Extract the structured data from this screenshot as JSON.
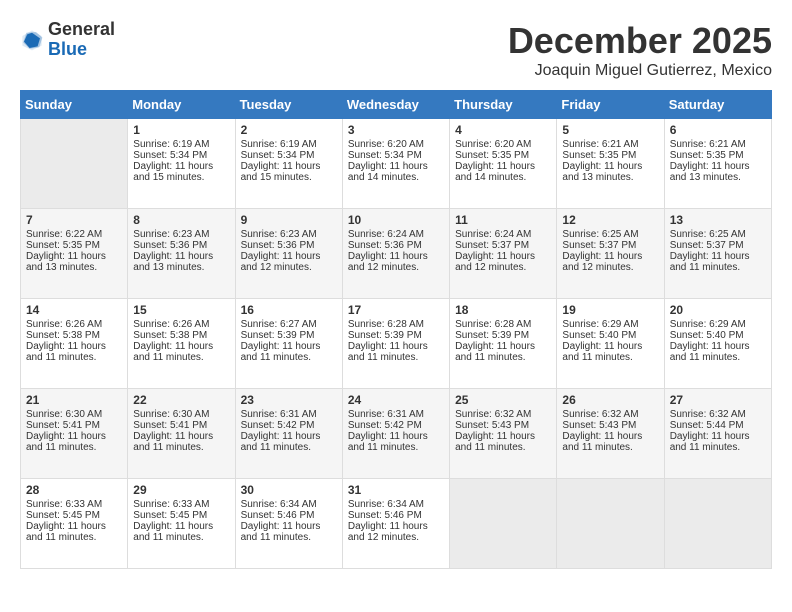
{
  "header": {
    "logo_general": "General",
    "logo_blue": "Blue",
    "month_title": "December 2025",
    "subtitle": "Joaquin Miguel Gutierrez, Mexico"
  },
  "days_of_week": [
    "Sunday",
    "Monday",
    "Tuesday",
    "Wednesday",
    "Thursday",
    "Friday",
    "Saturday"
  ],
  "weeks": [
    [
      {
        "day": "",
        "sunrise": "",
        "sunset": "",
        "daylight": ""
      },
      {
        "day": "1",
        "sunrise": "Sunrise: 6:19 AM",
        "sunset": "Sunset: 5:34 PM",
        "daylight": "Daylight: 11 hours and 15 minutes."
      },
      {
        "day": "2",
        "sunrise": "Sunrise: 6:19 AM",
        "sunset": "Sunset: 5:34 PM",
        "daylight": "Daylight: 11 hours and 15 minutes."
      },
      {
        "day": "3",
        "sunrise": "Sunrise: 6:20 AM",
        "sunset": "Sunset: 5:34 PM",
        "daylight": "Daylight: 11 hours and 14 minutes."
      },
      {
        "day": "4",
        "sunrise": "Sunrise: 6:20 AM",
        "sunset": "Sunset: 5:35 PM",
        "daylight": "Daylight: 11 hours and 14 minutes."
      },
      {
        "day": "5",
        "sunrise": "Sunrise: 6:21 AM",
        "sunset": "Sunset: 5:35 PM",
        "daylight": "Daylight: 11 hours and 13 minutes."
      },
      {
        "day": "6",
        "sunrise": "Sunrise: 6:21 AM",
        "sunset": "Sunset: 5:35 PM",
        "daylight": "Daylight: 11 hours and 13 minutes."
      }
    ],
    [
      {
        "day": "7",
        "sunrise": "Sunrise: 6:22 AM",
        "sunset": "Sunset: 5:35 PM",
        "daylight": "Daylight: 11 hours and 13 minutes."
      },
      {
        "day": "8",
        "sunrise": "Sunrise: 6:23 AM",
        "sunset": "Sunset: 5:36 PM",
        "daylight": "Daylight: 11 hours and 13 minutes."
      },
      {
        "day": "9",
        "sunrise": "Sunrise: 6:23 AM",
        "sunset": "Sunset: 5:36 PM",
        "daylight": "Daylight: 11 hours and 12 minutes."
      },
      {
        "day": "10",
        "sunrise": "Sunrise: 6:24 AM",
        "sunset": "Sunset: 5:36 PM",
        "daylight": "Daylight: 11 hours and 12 minutes."
      },
      {
        "day": "11",
        "sunrise": "Sunrise: 6:24 AM",
        "sunset": "Sunset: 5:37 PM",
        "daylight": "Daylight: 11 hours and 12 minutes."
      },
      {
        "day": "12",
        "sunrise": "Sunrise: 6:25 AM",
        "sunset": "Sunset: 5:37 PM",
        "daylight": "Daylight: 11 hours and 12 minutes."
      },
      {
        "day": "13",
        "sunrise": "Sunrise: 6:25 AM",
        "sunset": "Sunset: 5:37 PM",
        "daylight": "Daylight: 11 hours and 11 minutes."
      }
    ],
    [
      {
        "day": "14",
        "sunrise": "Sunrise: 6:26 AM",
        "sunset": "Sunset: 5:38 PM",
        "daylight": "Daylight: 11 hours and 11 minutes."
      },
      {
        "day": "15",
        "sunrise": "Sunrise: 6:26 AM",
        "sunset": "Sunset: 5:38 PM",
        "daylight": "Daylight: 11 hours and 11 minutes."
      },
      {
        "day": "16",
        "sunrise": "Sunrise: 6:27 AM",
        "sunset": "Sunset: 5:39 PM",
        "daylight": "Daylight: 11 hours and 11 minutes."
      },
      {
        "day": "17",
        "sunrise": "Sunrise: 6:28 AM",
        "sunset": "Sunset: 5:39 PM",
        "daylight": "Daylight: 11 hours and 11 minutes."
      },
      {
        "day": "18",
        "sunrise": "Sunrise: 6:28 AM",
        "sunset": "Sunset: 5:39 PM",
        "daylight": "Daylight: 11 hours and 11 minutes."
      },
      {
        "day": "19",
        "sunrise": "Sunrise: 6:29 AM",
        "sunset": "Sunset: 5:40 PM",
        "daylight": "Daylight: 11 hours and 11 minutes."
      },
      {
        "day": "20",
        "sunrise": "Sunrise: 6:29 AM",
        "sunset": "Sunset: 5:40 PM",
        "daylight": "Daylight: 11 hours and 11 minutes."
      }
    ],
    [
      {
        "day": "21",
        "sunrise": "Sunrise: 6:30 AM",
        "sunset": "Sunset: 5:41 PM",
        "daylight": "Daylight: 11 hours and 11 minutes."
      },
      {
        "day": "22",
        "sunrise": "Sunrise: 6:30 AM",
        "sunset": "Sunset: 5:41 PM",
        "daylight": "Daylight: 11 hours and 11 minutes."
      },
      {
        "day": "23",
        "sunrise": "Sunrise: 6:31 AM",
        "sunset": "Sunset: 5:42 PM",
        "daylight": "Daylight: 11 hours and 11 minutes."
      },
      {
        "day": "24",
        "sunrise": "Sunrise: 6:31 AM",
        "sunset": "Sunset: 5:42 PM",
        "daylight": "Daylight: 11 hours and 11 minutes."
      },
      {
        "day": "25",
        "sunrise": "Sunrise: 6:32 AM",
        "sunset": "Sunset: 5:43 PM",
        "daylight": "Daylight: 11 hours and 11 minutes."
      },
      {
        "day": "26",
        "sunrise": "Sunrise: 6:32 AM",
        "sunset": "Sunset: 5:43 PM",
        "daylight": "Daylight: 11 hours and 11 minutes."
      },
      {
        "day": "27",
        "sunrise": "Sunrise: 6:32 AM",
        "sunset": "Sunset: 5:44 PM",
        "daylight": "Daylight: 11 hours and 11 minutes."
      }
    ],
    [
      {
        "day": "28",
        "sunrise": "Sunrise: 6:33 AM",
        "sunset": "Sunset: 5:45 PM",
        "daylight": "Daylight: 11 hours and 11 minutes."
      },
      {
        "day": "29",
        "sunrise": "Sunrise: 6:33 AM",
        "sunset": "Sunset: 5:45 PM",
        "daylight": "Daylight: 11 hours and 11 minutes."
      },
      {
        "day": "30",
        "sunrise": "Sunrise: 6:34 AM",
        "sunset": "Sunset: 5:46 PM",
        "daylight": "Daylight: 11 hours and 11 minutes."
      },
      {
        "day": "31",
        "sunrise": "Sunrise: 6:34 AM",
        "sunset": "Sunset: 5:46 PM",
        "daylight": "Daylight: 11 hours and 12 minutes."
      },
      {
        "day": "",
        "sunrise": "",
        "sunset": "",
        "daylight": ""
      },
      {
        "day": "",
        "sunrise": "",
        "sunset": "",
        "daylight": ""
      },
      {
        "day": "",
        "sunrise": "",
        "sunset": "",
        "daylight": ""
      }
    ]
  ]
}
